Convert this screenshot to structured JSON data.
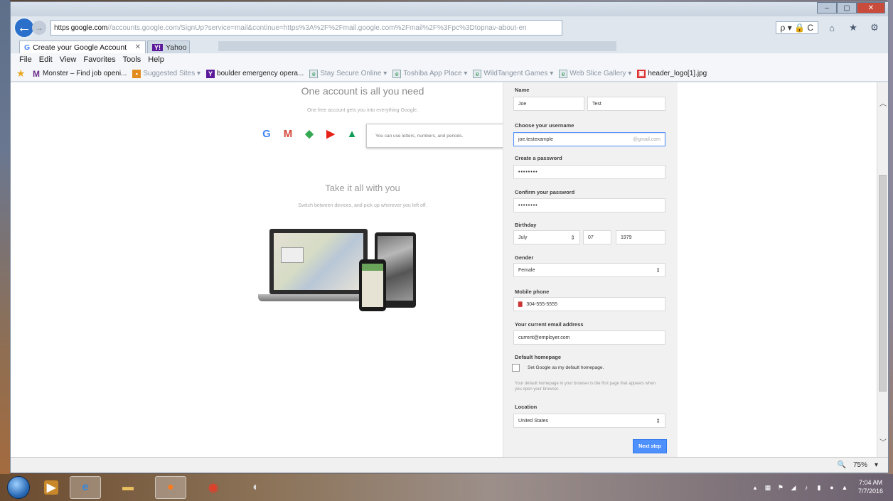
{
  "window": {
    "controls": {
      "minimize": "–",
      "maximize": "▢",
      "close": "✕"
    }
  },
  "address": {
    "protocol": "https",
    "host": "google.com",
    "url_rest": "//accounts.google.com/SignUp?service=mail&continue=https%3A%2F%2Fmail.google.com%2Fmail%2F%3Fpc%3Dtopnav-about-en",
    "search": "ρ ▾ 🔒 C"
  },
  "tabs": [
    {
      "label": "Create your Google Account",
      "active": true,
      "favicon": "G"
    },
    {
      "label": "Yahoo",
      "active": false,
      "favicon": "Y!"
    }
  ],
  "menu": [
    "File",
    "Edit",
    "View",
    "Favorites",
    "Tools",
    "Help"
  ],
  "favorites": [
    {
      "label": "Monster – Find job openi...",
      "icon": "monster-icon"
    },
    {
      "label": "Suggested Sites ▾",
      "icon": "suggested-sites-icon"
    },
    {
      "label": "boulder emergency opera...",
      "icon": "yahoo-icon"
    },
    {
      "label": "Stay Secure Online ▾",
      "icon": "page-icon"
    },
    {
      "label": "Toshiba App Place ▾",
      "icon": "page-icon"
    },
    {
      "label": "WildTangent Games ▾",
      "icon": "page-icon"
    },
    {
      "label": "Web Slice Gallery ▾",
      "icon": "page-icon"
    },
    {
      "label": "header_logo[1].jpg",
      "icon": "image-icon"
    }
  ],
  "page": {
    "heading1": "One account is all you need",
    "sub1": "One free account gets you into everything Google.",
    "heading2": "Take it all with you",
    "sub2": "Switch between devices, and pick up wherever you left off.",
    "tooltip": "You can use letters, numbers, and periods."
  },
  "form": {
    "name_label": "Name",
    "first_name": "Joe",
    "last_name": "Test",
    "username_label": "Choose your username",
    "username_value": "joe.testexample",
    "username_suffix": "@gmail.com",
    "password_label": "Create a password",
    "password_value": "••••••••",
    "confirm_label": "Confirm your password",
    "confirm_value": "••••••••",
    "birthday_label": "Birthday",
    "birthday_month": "July",
    "birthday_day": "07",
    "birthday_year": "1979",
    "gender_label": "Gender",
    "gender_value": "Female",
    "phone_label": "Mobile phone",
    "phone_flag": "▇",
    "phone_value": "304-555-5555",
    "email_label": "Your current email address",
    "email_value": "current@employer.com",
    "homepage_label": "Default homepage",
    "homepage_checkbox": "Set Google as my default homepage.",
    "homepage_help": "Your default homepage in your browser is the first page that appears when you open your browser.",
    "location_label": "Location",
    "location_value": "United States",
    "next_button": "Next step"
  },
  "status": {
    "zoom": "75%"
  },
  "clock": {
    "time": "7:04 AM",
    "date": "7/7/2016"
  }
}
